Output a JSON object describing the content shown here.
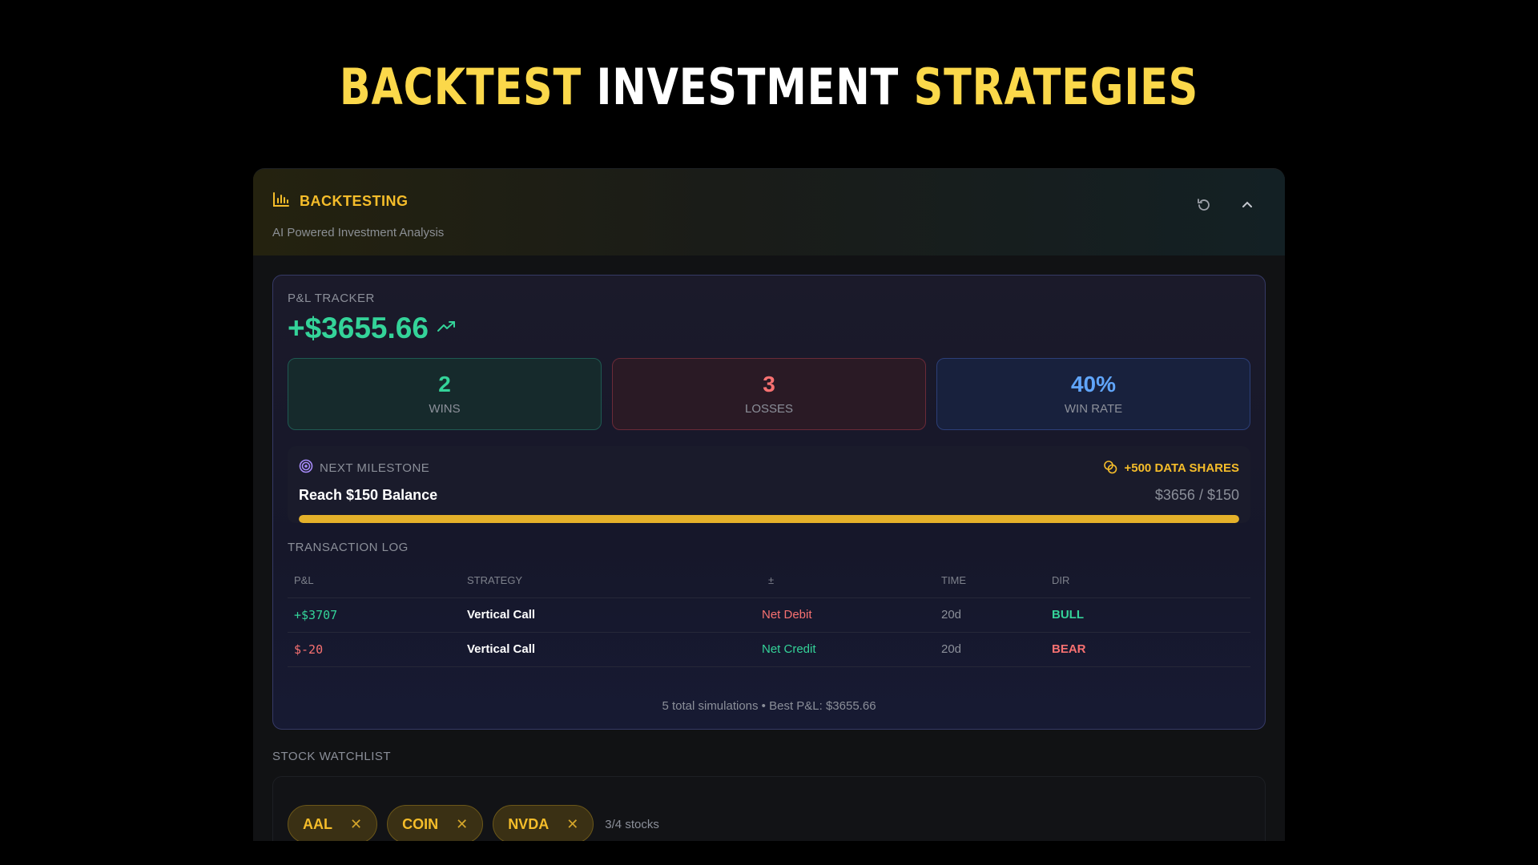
{
  "hero": {
    "part1": "BACKTEST",
    "part2": "INVESTMENT",
    "part3": "STRATEGIES"
  },
  "header": {
    "title": "BACKTESTING",
    "subtitle": "AI Powered Investment Analysis"
  },
  "tracker": {
    "label": "P&L TRACKER",
    "value": "+$3655.66",
    "stats": [
      {
        "value": "2",
        "label": "WINS"
      },
      {
        "value": "3",
        "label": "LOSSES"
      },
      {
        "value": "40%",
        "label": "WIN RATE"
      }
    ],
    "milestone": {
      "label": "NEXT MILESTONE",
      "reward": "+500 DATA SHARES",
      "goal": "Reach $150 Balance",
      "progress_text": "$3656 / $150",
      "progress_fraction": 1.0
    }
  },
  "transactions": {
    "title": "TRANSACTION LOG",
    "headers": [
      "P&L",
      "STRATEGY",
      "±",
      "TIME",
      "DIR"
    ],
    "rows": [
      {
        "pnl": "+$3707",
        "strategy": "Vertical Call",
        "type": "Net Debit",
        "time": "20d",
        "dir": "BULL"
      },
      {
        "pnl": "$-20",
        "strategy": "Vertical Call",
        "type": "Net Credit",
        "time": "20d",
        "dir": "BEAR"
      }
    ],
    "summary": "5 total simulations • Best P&L: $3655.66"
  },
  "watchlist": {
    "label": "STOCK WATCHLIST",
    "stocks": [
      "AAL",
      "COIN",
      "NVDA"
    ],
    "count": "3/4 stocks"
  },
  "colors": {
    "accent": "#f5bd2a",
    "positive": "#34d399",
    "negative": "#f87171",
    "info": "#60a5fa"
  }
}
